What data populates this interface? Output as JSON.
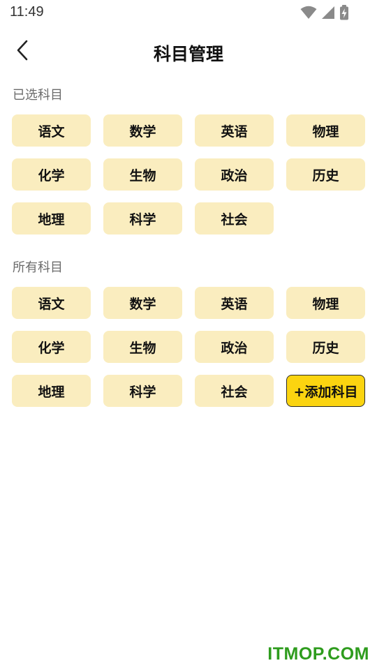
{
  "status_bar": {
    "time": "11:49",
    "icons": [
      "wifi-icon",
      "signal-icon",
      "battery-charging-icon"
    ]
  },
  "header": {
    "title": "科目管理",
    "back_icon": "chevron-left-icon"
  },
  "selected_section": {
    "title": "已选科目",
    "subjects": [
      "语文",
      "数学",
      "英语",
      "物理",
      "化学",
      "生物",
      "政治",
      "历史",
      "地理",
      "科学",
      "社会"
    ]
  },
  "all_section": {
    "title": "所有科目",
    "subjects": [
      "语文",
      "数学",
      "英语",
      "物理",
      "化学",
      "生物",
      "政治",
      "历史",
      "地理",
      "科学",
      "社会"
    ],
    "add_label": "+添加科目"
  },
  "watermark": "ITMOP.COM",
  "colors": {
    "chip_background": "#faedbf",
    "add_button": "#fbd410",
    "watermark": "#2e9c1d"
  }
}
